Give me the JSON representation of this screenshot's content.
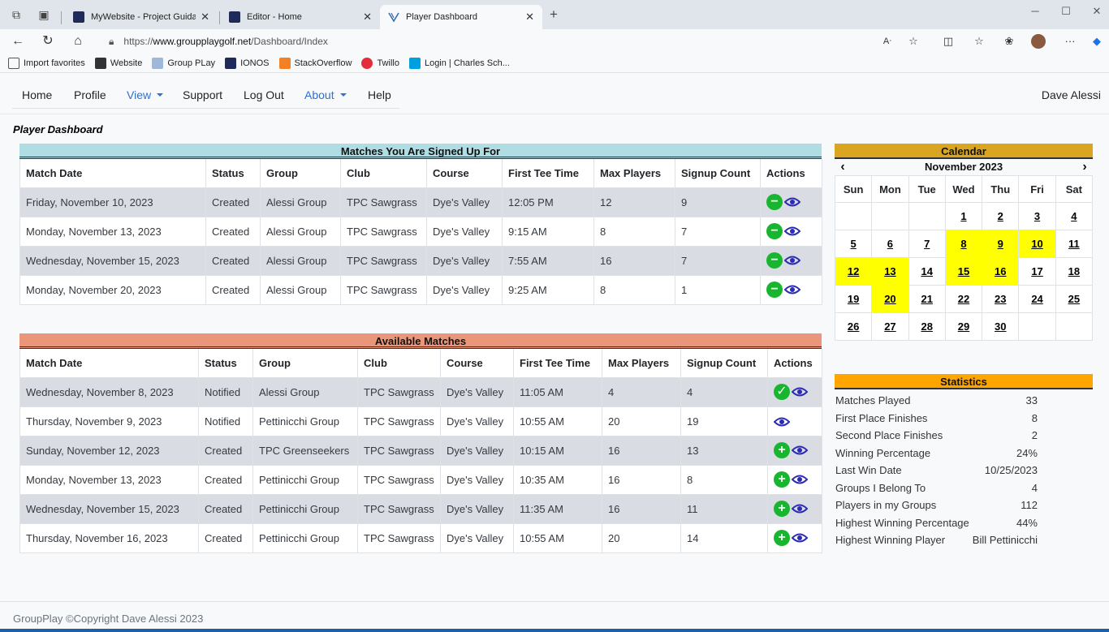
{
  "browser": {
    "tabs": [
      {
        "label": "MyWebsite - Project Guidance Do",
        "active": false
      },
      {
        "label": "Editor - Home",
        "active": false
      },
      {
        "label": "Player Dashboard",
        "active": true
      }
    ],
    "new_tab": "+",
    "url_prefix": "https://",
    "url_host": "www.groupplaygolf.net",
    "url_path": "/Dashboard/Index",
    "favorites": [
      "Import favorites",
      "Website",
      "Group PLay",
      "IONOS",
      "StackOverflow",
      "Twillo",
      "Login | Charles Sch..."
    ]
  },
  "nav": {
    "home": "Home",
    "profile": "Profile",
    "view": "View",
    "support": "Support",
    "logout": "Log Out",
    "about": "About",
    "help": "Help",
    "user": "Dave Alessi"
  },
  "page_title": "Player Dashboard",
  "signed_up": {
    "title": "Matches You Are Signed Up For",
    "columns": [
      "Match Date",
      "Status",
      "Group",
      "Club",
      "Course",
      "First Tee Time",
      "Max Players",
      "Signup Count",
      "Actions"
    ],
    "rows": [
      [
        "Friday, November 10, 2023",
        "Created",
        "Alessi Group",
        "TPC Sawgrass",
        "Dye's Valley",
        "12:05 PM",
        "12",
        "9"
      ],
      [
        "Monday, November 13, 2023",
        "Created",
        "Alessi Group",
        "TPC Sawgrass",
        "Dye's Valley",
        "9:15 AM",
        "8",
        "7"
      ],
      [
        "Wednesday, November 15, 2023",
        "Created",
        "Alessi Group",
        "TPC Sawgrass",
        "Dye's Valley",
        "7:55 AM",
        "16",
        "7"
      ],
      [
        "Monday, November 20, 2023",
        "Created",
        "Alessi Group",
        "TPC Sawgrass",
        "Dye's Valley",
        "9:25 AM",
        "8",
        "1"
      ]
    ]
  },
  "available": {
    "title": "Available Matches",
    "columns": [
      "Match Date",
      "Status",
      "Group",
      "Club",
      "Course",
      "First Tee Time",
      "Max Players",
      "Signup Count",
      "Actions"
    ],
    "rows": [
      [
        "Wednesday, November 8, 2023",
        "Notified",
        "Alessi Group",
        "TPC Sawgrass",
        "Dye's Valley",
        "11:05 AM",
        "4",
        "4"
      ],
      [
        "Thursday, November 9, 2023",
        "Notified",
        "Pettinicchi Group",
        "TPC Sawgrass",
        "Dye's Valley",
        "10:55 AM",
        "20",
        "19"
      ],
      [
        "Sunday, November 12, 2023",
        "Created",
        "TPC Greenseekers",
        "TPC Sawgrass",
        "Dye's Valley",
        "10:15 AM",
        "16",
        "13"
      ],
      [
        "Monday, November 13, 2023",
        "Created",
        "Pettinicchi Group",
        "TPC Sawgrass",
        "Dye's Valley",
        "10:35 AM",
        "16",
        "8"
      ],
      [
        "Wednesday, November 15, 2023",
        "Created",
        "Pettinicchi Group",
        "TPC Sawgrass",
        "Dye's Valley",
        "11:35 AM",
        "16",
        "11"
      ],
      [
        "Thursday, November 16, 2023",
        "Created",
        "Pettinicchi Group",
        "TPC Sawgrass",
        "Dye's Valley",
        "10:55 AM",
        "20",
        "14"
      ]
    ],
    "actions": [
      "check",
      "none",
      "plus",
      "plus",
      "plus",
      "plus"
    ]
  },
  "calendar": {
    "title": "Calendar",
    "month": "November 2023",
    "prev": "‹",
    "next": "›",
    "weekdays": [
      "Sun",
      "Mon",
      "Tue",
      "Wed",
      "Thu",
      "Fri",
      "Sat"
    ],
    "weeks": [
      [
        "",
        "",
        "",
        "1",
        "2",
        "3",
        "4"
      ],
      [
        "5",
        "6",
        "7",
        "8",
        "9",
        "10",
        "11"
      ],
      [
        "12",
        "13",
        "14",
        "15",
        "16",
        "17",
        "18"
      ],
      [
        "19",
        "20",
        "21",
        "22",
        "23",
        "24",
        "25"
      ],
      [
        "26",
        "27",
        "28",
        "29",
        "30",
        "",
        ""
      ]
    ],
    "highlighted": [
      "8",
      "9",
      "10",
      "12",
      "13",
      "15",
      "16",
      "20"
    ],
    "highlight_color": "#ffff00"
  },
  "statistics": {
    "title": "Statistics",
    "rows": [
      [
        "Matches Played",
        "33"
      ],
      [
        "First Place Finishes",
        "8"
      ],
      [
        "Second Place Finishes",
        "2"
      ],
      [
        "Winning Percentage",
        "24%"
      ],
      [
        "Last Win Date",
        "10/25/2023"
      ],
      [
        "Groups I Belong To",
        "4"
      ],
      [
        "Players in my Groups",
        "112"
      ],
      [
        "Highest Winning Percentage",
        "44%"
      ],
      [
        "Highest Winning Player",
        "Bill Pettinicchi"
      ]
    ]
  },
  "footer": "GroupPlay ©Copyright Dave Alessi 2023",
  "colors": {
    "signed_up_header": "#b0dde4",
    "available_header": "#e9967a",
    "calendar_header": "#daa520",
    "stats_header": "#ffa500",
    "action_green": "#18b52e",
    "eye_blue": "#2b2bb5"
  }
}
